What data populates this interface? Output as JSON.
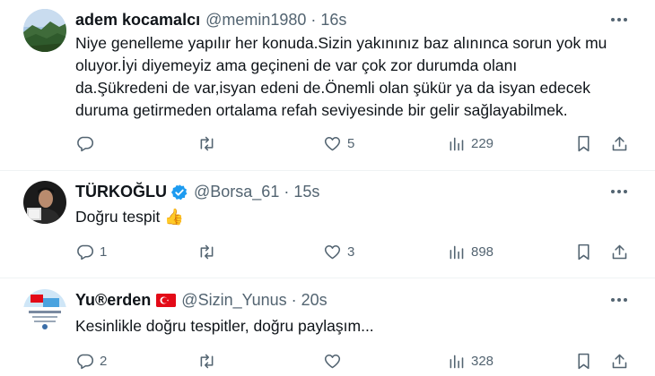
{
  "tweets": [
    {
      "name": "adem kocamalcı",
      "handle": "@memin1980",
      "separator": "·",
      "time": "16s",
      "text": "Niye genelleme yapılır her konuda.Sizin yakınınız baz alınınca sorun yok mu\noluyor.İyi diyemeyiz ama geçineni de var çok zor durumda olanı\nda.Şükredeni de var,isyan edeni de.Önemli olan şükür ya da isyan edecek\nduruma getirmeden ortalama refah seviyesinde bir gelir sağlayabilmek.",
      "replies": "",
      "retweets": "",
      "likes": "5",
      "views": "229"
    },
    {
      "name": "TÜRKOĞLU",
      "handle": "@Borsa_61",
      "separator": "·",
      "time": "15s",
      "text": "Doğru tespit 👍",
      "replies": "1",
      "retweets": "",
      "likes": "3",
      "views": "898"
    },
    {
      "name": "Yu®erden",
      "handle": "@Sizin_Yunus",
      "separator": "·",
      "time": "20s",
      "text": "Kesinlikle doğru tespitler, doğru paylaşım...",
      "replies": "2",
      "retweets": "",
      "likes": "",
      "views": "328"
    }
  ],
  "icons": {
    "more": "more-horizontal-icon",
    "reply": "reply-icon",
    "retweet": "retweet-icon",
    "like": "heart-icon",
    "views": "views-chart-icon",
    "bookmark": "bookmark-icon",
    "share": "share-icon",
    "verified": "verified-badge-icon",
    "flag": "turkey-flag-icon"
  },
  "colors": {
    "text": "#0f1419",
    "secondary": "#536471",
    "verified": "#1d9bf0",
    "flag": "#e30a17"
  }
}
